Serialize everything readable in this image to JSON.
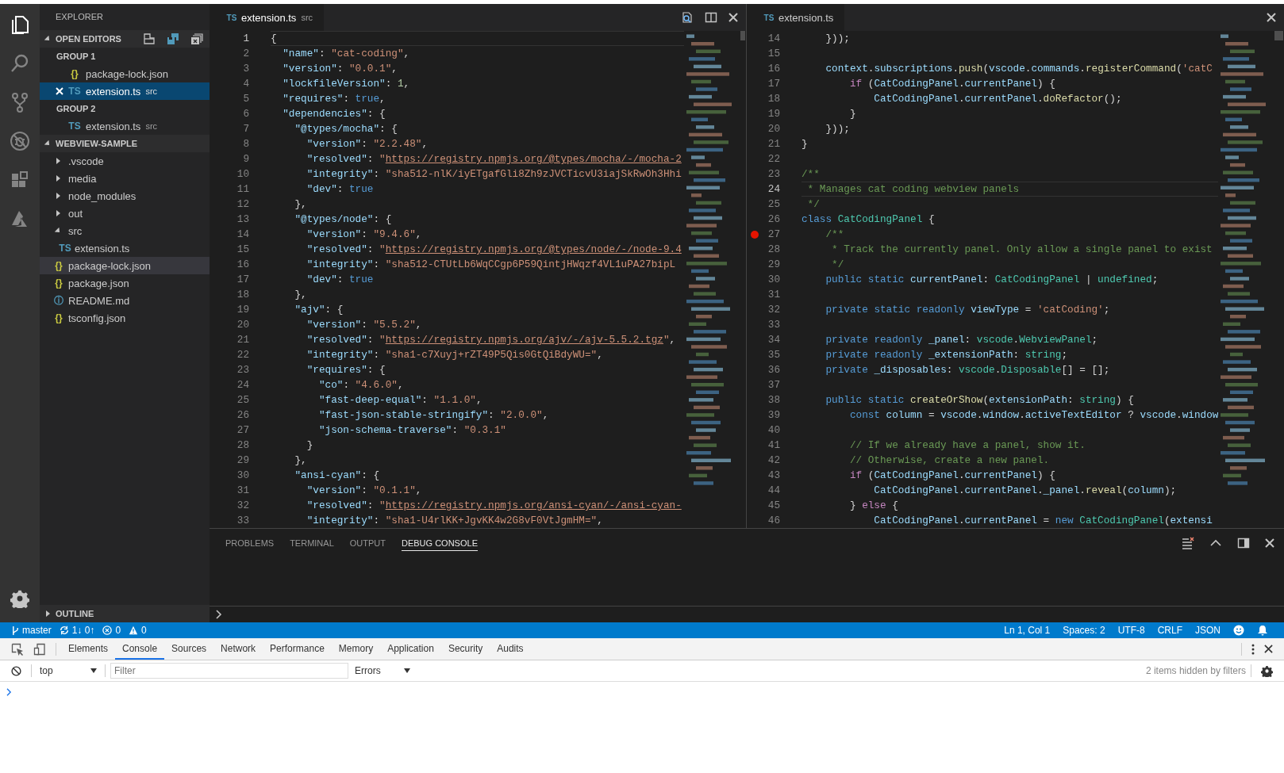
{
  "activity": [
    {
      "kind": "explorer",
      "selected": true
    },
    {
      "kind": "search",
      "selected": false
    },
    {
      "kind": "scm",
      "selected": false
    },
    {
      "kind": "debug",
      "selected": false
    },
    {
      "kind": "extensions",
      "selected": false
    },
    {
      "kind": "azure",
      "selected": false
    }
  ],
  "sidebar": {
    "title": "EXPLORER",
    "open_editors": {
      "title": "OPEN EDITORS",
      "expanded": true,
      "groups": [
        {
          "title": "GROUP 1",
          "files": [
            {
              "icon": "{}",
              "color": "#cbcb41",
              "name": "package-lock.json",
              "selected": false
            },
            {
              "icon": "TS",
              "color": "#519aba",
              "name": "extension.ts",
              "folder": "src",
              "selected": true
            }
          ]
        },
        {
          "title": "GROUP 2",
          "files": [
            {
              "icon": "TS",
              "color": "#519aba",
              "name": "extension.ts",
              "folder": "src",
              "selected": false
            }
          ]
        }
      ]
    },
    "workspace": {
      "title": "WEBVIEW-SAMPLE",
      "expanded": true,
      "items": [
        {
          "name": ".vscode",
          "kind": "folder",
          "expanded": false,
          "selected": false
        },
        {
          "name": "media",
          "kind": "folder",
          "expanded": false,
          "selected": false
        },
        {
          "name": "node_modules",
          "kind": "folder",
          "expanded": false,
          "selected": false
        },
        {
          "name": "out",
          "kind": "folder",
          "expanded": false,
          "selected": false
        },
        {
          "name": "src",
          "kind": "folder",
          "expanded": true,
          "selected": false,
          "children": [
            {
              "name": "extension.ts",
              "icon": "TS",
              "color": "#519aba",
              "selected": false
            }
          ]
        },
        {
          "name": "package-lock.json",
          "kind": "file",
          "icon": "{}",
          "color": "#cbcb41",
          "selected": true
        },
        {
          "name": "package.json",
          "kind": "file",
          "icon": "{}",
          "color": "#cbcb41",
          "selected": false
        },
        {
          "name": "README.md",
          "kind": "file",
          "icon": "ⓘ",
          "color": "#519aba",
          "selected": false
        },
        {
          "name": "tsconfig.json",
          "kind": "file",
          "icon": "{}",
          "color": "#cbcb41",
          "selected": false
        }
      ]
    },
    "outline": {
      "title": "OUTLINE",
      "expanded": false
    }
  },
  "editor_groups": [
    {
      "tab": {
        "icon": "TS",
        "name": "extension.ts",
        "folder": "src"
      },
      "actions": [
        {
          "kind": "open-changes"
        },
        {
          "kind": "split"
        },
        {
          "kind": "close"
        }
      ],
      "lines": [
        {
          "number": "1",
          "current": true,
          "tokens": [
            {
              "kind": "punct",
              "text": "{"
            }
          ]
        },
        {
          "number": "2",
          "current": false,
          "tokens": [
            {
              "kind": "key",
              "text": "  \"name\""
            },
            {
              "kind": "punct",
              "text": ": "
            },
            {
              "kind": "str",
              "text": "\"cat-coding\""
            },
            {
              "kind": "punct",
              "text": ","
            }
          ]
        },
        {
          "number": "3",
          "current": false,
          "tokens": [
            {
              "kind": "key",
              "text": "  \"version\""
            },
            {
              "kind": "punct",
              "text": ": "
            },
            {
              "kind": "str",
              "text": "\"0.0.1\""
            },
            {
              "kind": "punct",
              "text": ","
            }
          ]
        },
        {
          "number": "4",
          "current": false,
          "tokens": [
            {
              "kind": "key",
              "text": "  \"lockfileVersion\""
            },
            {
              "kind": "punct",
              "text": ": "
            },
            {
              "kind": "num",
              "text": "1"
            },
            {
              "kind": "punct",
              "text": ","
            }
          ]
        },
        {
          "number": "5",
          "current": false,
          "tokens": [
            {
              "kind": "key",
              "text": "  \"requires\""
            },
            {
              "kind": "punct",
              "text": ": "
            },
            {
              "kind": "bool",
              "text": "true"
            },
            {
              "kind": "punct",
              "text": ","
            }
          ]
        },
        {
          "number": "6",
          "current": false,
          "tokens": [
            {
              "kind": "key",
              "text": "  \"dependencies\""
            },
            {
              "kind": "punct",
              "text": ": {"
            }
          ]
        },
        {
          "number": "7",
          "current": false,
          "tokens": [
            {
              "kind": "key",
              "text": "    \"@types/mocha\""
            },
            {
              "kind": "punct",
              "text": ": {"
            }
          ]
        },
        {
          "number": "8",
          "current": false,
          "tokens": [
            {
              "kind": "key",
              "text": "      \"version\""
            },
            {
              "kind": "punct",
              "text": ": "
            },
            {
              "kind": "str",
              "text": "\"2.2.48\""
            },
            {
              "kind": "punct",
              "text": ","
            }
          ]
        },
        {
          "number": "9",
          "current": false,
          "tokens": [
            {
              "kind": "key",
              "text": "      \"resolved\""
            },
            {
              "kind": "punct",
              "text": ": "
            },
            {
              "kind": "str",
              "text": "\""
            },
            {
              "kind": "link",
              "text": "https://registry.npmjs.org/@types/mocha/-/mocha-2"
            }
          ]
        },
        {
          "number": "10",
          "current": false,
          "tokens": [
            {
              "kind": "key",
              "text": "      \"integrity\""
            },
            {
              "kind": "punct",
              "text": ": "
            },
            {
              "kind": "str",
              "text": "\"sha512-nlK/iyETgafGli8Zh9zJVCTicvU3iajSkRwOh3Hhi"
            }
          ]
        },
        {
          "number": "11",
          "current": false,
          "tokens": [
            {
              "kind": "key",
              "text": "      \"dev\""
            },
            {
              "kind": "punct",
              "text": ": "
            },
            {
              "kind": "bool",
              "text": "true"
            }
          ]
        },
        {
          "number": "12",
          "current": false,
          "tokens": [
            {
              "kind": "punct",
              "text": "    },"
            }
          ]
        },
        {
          "number": "13",
          "current": false,
          "tokens": [
            {
              "kind": "key",
              "text": "    \"@types/node\""
            },
            {
              "kind": "punct",
              "text": ": {"
            }
          ]
        },
        {
          "number": "14",
          "current": false,
          "tokens": [
            {
              "kind": "key",
              "text": "      \"version\""
            },
            {
              "kind": "punct",
              "text": ": "
            },
            {
              "kind": "str",
              "text": "\"9.4.6\""
            },
            {
              "kind": "punct",
              "text": ","
            }
          ]
        },
        {
          "number": "15",
          "current": false,
          "tokens": [
            {
              "kind": "key",
              "text": "      \"resolved\""
            },
            {
              "kind": "punct",
              "text": ": "
            },
            {
              "kind": "str",
              "text": "\""
            },
            {
              "kind": "link",
              "text": "https://registry.npmjs.org/@types/node/-/node-9.4"
            }
          ]
        },
        {
          "number": "16",
          "current": false,
          "tokens": [
            {
              "kind": "key",
              "text": "      \"integrity\""
            },
            {
              "kind": "punct",
              "text": ": "
            },
            {
              "kind": "str",
              "text": "\"sha512-CTUtLb6WqCCgp6P59QintjHWqzf4VL1uPA27bipL"
            }
          ]
        },
        {
          "number": "17",
          "current": false,
          "tokens": [
            {
              "kind": "key",
              "text": "      \"dev\""
            },
            {
              "kind": "punct",
              "text": ": "
            },
            {
              "kind": "bool",
              "text": "true"
            }
          ]
        },
        {
          "number": "18",
          "current": false,
          "tokens": [
            {
              "kind": "punct",
              "text": "    },"
            }
          ]
        },
        {
          "number": "19",
          "current": false,
          "tokens": [
            {
              "kind": "key",
              "text": "    \"ajv\""
            },
            {
              "kind": "punct",
              "text": ": {"
            }
          ]
        },
        {
          "number": "20",
          "current": false,
          "tokens": [
            {
              "kind": "key",
              "text": "      \"version\""
            },
            {
              "kind": "punct",
              "text": ": "
            },
            {
              "kind": "str",
              "text": "\"5.5.2\""
            },
            {
              "kind": "punct",
              "text": ","
            }
          ]
        },
        {
          "number": "21",
          "current": false,
          "tokens": [
            {
              "kind": "key",
              "text": "      \"resolved\""
            },
            {
              "kind": "punct",
              "text": ": "
            },
            {
              "kind": "str",
              "text": "\""
            },
            {
              "kind": "link",
              "text": "https://registry.npmjs.org/ajv/-/ajv-5.5.2.tgz"
            },
            {
              "kind": "str",
              "text": "\""
            },
            {
              "kind": "punct",
              "text": ","
            }
          ]
        },
        {
          "number": "22",
          "current": false,
          "tokens": [
            {
              "kind": "key",
              "text": "      \"integrity\""
            },
            {
              "kind": "punct",
              "text": ": "
            },
            {
              "kind": "str",
              "text": "\"sha1-c7Xuyj+rZT49P5Qis0GtQiBdyWU=\""
            },
            {
              "kind": "punct",
              "text": ","
            }
          ]
        },
        {
          "number": "23",
          "current": false,
          "tokens": [
            {
              "kind": "key",
              "text": "      \"requires\""
            },
            {
              "kind": "punct",
              "text": ": {"
            }
          ]
        },
        {
          "number": "24",
          "current": false,
          "tokens": [
            {
              "kind": "key",
              "text": "        \"co\""
            },
            {
              "kind": "punct",
              "text": ": "
            },
            {
              "kind": "str",
              "text": "\"4.6.0\""
            },
            {
              "kind": "punct",
              "text": ","
            }
          ]
        },
        {
          "number": "25",
          "current": false,
          "tokens": [
            {
              "kind": "key",
              "text": "        \"fast-deep-equal\""
            },
            {
              "kind": "punct",
              "text": ": "
            },
            {
              "kind": "str",
              "text": "\"1.1.0\""
            },
            {
              "kind": "punct",
              "text": ","
            }
          ]
        },
        {
          "number": "26",
          "current": false,
          "tokens": [
            {
              "kind": "key",
              "text": "        \"fast-json-stable-stringify\""
            },
            {
              "kind": "punct",
              "text": ": "
            },
            {
              "kind": "str",
              "text": "\"2.0.0\""
            },
            {
              "kind": "punct",
              "text": ","
            }
          ]
        },
        {
          "number": "27",
          "current": false,
          "tokens": [
            {
              "kind": "key",
              "text": "        \"json-schema-traverse\""
            },
            {
              "kind": "punct",
              "text": ": "
            },
            {
              "kind": "str",
              "text": "\"0.3.1\""
            }
          ]
        },
        {
          "number": "28",
          "current": false,
          "tokens": [
            {
              "kind": "punct",
              "text": "      }"
            }
          ]
        },
        {
          "number": "29",
          "current": false,
          "tokens": [
            {
              "kind": "punct",
              "text": "    },"
            }
          ]
        },
        {
          "number": "30",
          "current": false,
          "tokens": [
            {
              "kind": "key",
              "text": "    \"ansi-cyan\""
            },
            {
              "kind": "punct",
              "text": ": {"
            }
          ]
        },
        {
          "number": "31",
          "current": false,
          "tokens": [
            {
              "kind": "key",
              "text": "      \"version\""
            },
            {
              "kind": "punct",
              "text": ": "
            },
            {
              "kind": "str",
              "text": "\"0.1.1\""
            },
            {
              "kind": "punct",
              "text": ","
            }
          ]
        },
        {
          "number": "32",
          "current": false,
          "tokens": [
            {
              "kind": "key",
              "text": "      \"resolved\""
            },
            {
              "kind": "punct",
              "text": ": "
            },
            {
              "kind": "str",
              "text": "\""
            },
            {
              "kind": "link",
              "text": "https://registry.npmjs.org/ansi-cyan/-/ansi-cyan-"
            }
          ]
        },
        {
          "number": "33",
          "current": false,
          "tokens": [
            {
              "kind": "key",
              "text": "      \"integrity\""
            },
            {
              "kind": "punct",
              "text": ": "
            },
            {
              "kind": "str",
              "text": "\"sha1-U4rlKK+JgvKK4w2G8vF0VtJgmHM=\""
            },
            {
              "kind": "punct",
              "text": ","
            }
          ]
        }
      ]
    },
    {
      "tab": {
        "icon": "TS",
        "name": "extension.ts"
      },
      "actions": [
        {
          "kind": "close"
        }
      ],
      "lines": [
        {
          "number": "14",
          "current": false,
          "breakpoint": false,
          "tokens": [
            {
              "kind": "punct",
              "text": "    }));"
            }
          ]
        },
        {
          "number": "15",
          "current": false,
          "breakpoint": false
        },
        {
          "number": "16",
          "current": false,
          "breakpoint": false,
          "tokens": [
            {
              "kind": "var",
              "text": "    context"
            },
            {
              "kind": "punct",
              "text": "."
            },
            {
              "kind": "var",
              "text": "subscriptions"
            },
            {
              "kind": "punct",
              "text": "."
            },
            {
              "kind": "func",
              "text": "push"
            },
            {
              "kind": "punct",
              "text": "("
            },
            {
              "kind": "var",
              "text": "vscode"
            },
            {
              "kind": "punct",
              "text": "."
            },
            {
              "kind": "var",
              "text": "commands"
            },
            {
              "kind": "punct",
              "text": "."
            },
            {
              "kind": "func",
              "text": "registerCommand"
            },
            {
              "kind": "punct",
              "text": "("
            },
            {
              "kind": "str",
              "text": "'catC"
            }
          ]
        },
        {
          "number": "17",
          "current": false,
          "breakpoint": false,
          "tokens": [
            {
              "kind": "ctrl",
              "text": "        if"
            },
            {
              "kind": "punct",
              "text": " ("
            },
            {
              "kind": "var",
              "text": "CatCodingPanel"
            },
            {
              "kind": "punct",
              "text": "."
            },
            {
              "kind": "var",
              "text": "currentPanel"
            },
            {
              "kind": "punct",
              "text": ") {"
            }
          ]
        },
        {
          "number": "18",
          "current": false,
          "breakpoint": false,
          "tokens": [
            {
              "kind": "var",
              "text": "            CatCodingPanel"
            },
            {
              "kind": "punct",
              "text": "."
            },
            {
              "kind": "var",
              "text": "currentPanel"
            },
            {
              "kind": "punct",
              "text": "."
            },
            {
              "kind": "func",
              "text": "doRefactor"
            },
            {
              "kind": "punct",
              "text": "();"
            }
          ]
        },
        {
          "number": "19",
          "current": false,
          "breakpoint": false,
          "tokens": [
            {
              "kind": "punct",
              "text": "        }"
            }
          ]
        },
        {
          "number": "20",
          "current": false,
          "breakpoint": false,
          "tokens": [
            {
              "kind": "punct",
              "text": "    }));"
            }
          ]
        },
        {
          "number": "21",
          "current": false,
          "breakpoint": false,
          "tokens": [
            {
              "kind": "punct",
              "text": "}"
            }
          ]
        },
        {
          "number": "22",
          "current": false,
          "breakpoint": false
        },
        {
          "number": "23",
          "current": false,
          "breakpoint": false,
          "tokens": [
            {
              "kind": "comment",
              "text": "/**"
            }
          ]
        },
        {
          "number": "24",
          "current": true,
          "breakpoint": false,
          "tokens": [
            {
              "kind": "comment",
              "text": " * Manages cat coding webview panels"
            }
          ]
        },
        {
          "number": "25",
          "current": false,
          "breakpoint": false,
          "tokens": [
            {
              "kind": "comment",
              "text": " */"
            }
          ]
        },
        {
          "number": "26",
          "current": false,
          "breakpoint": false,
          "tokens": [
            {
              "kind": "kw",
              "text": "class "
            },
            {
              "kind": "type",
              "text": "CatCodingPanel"
            },
            {
              "kind": "punct",
              "text": " {"
            }
          ]
        },
        {
          "number": "27",
          "current": false,
          "breakpoint": true,
          "tokens": [
            {
              "kind": "comment",
              "text": "    /**"
            }
          ]
        },
        {
          "number": "28",
          "current": false,
          "breakpoint": false,
          "tokens": [
            {
              "kind": "comment",
              "text": "     * Track the currently panel. Only allow a single panel to exist"
            }
          ]
        },
        {
          "number": "29",
          "current": false,
          "breakpoint": false,
          "tokens": [
            {
              "kind": "comment",
              "text": "     */"
            }
          ]
        },
        {
          "number": "30",
          "current": false,
          "breakpoint": false,
          "tokens": [
            {
              "kind": "kw",
              "text": "    public "
            },
            {
              "kind": "kw",
              "text": "static "
            },
            {
              "kind": "var",
              "text": "currentPanel"
            },
            {
              "kind": "punct",
              "text": ": "
            },
            {
              "kind": "type",
              "text": "CatCodingPanel"
            },
            {
              "kind": "punct",
              "text": " | "
            },
            {
              "kind": "type",
              "text": "undefined"
            },
            {
              "kind": "punct",
              "text": ";"
            }
          ]
        },
        {
          "number": "31",
          "current": false,
          "breakpoint": false
        },
        {
          "number": "32",
          "current": false,
          "breakpoint": false,
          "tokens": [
            {
              "kind": "kw",
              "text": "    private "
            },
            {
              "kind": "kw",
              "text": "static "
            },
            {
              "kind": "kw",
              "text": "readonly "
            },
            {
              "kind": "var",
              "text": "viewType"
            },
            {
              "kind": "punct",
              "text": " = "
            },
            {
              "kind": "str",
              "text": "'catCoding'"
            },
            {
              "kind": "punct",
              "text": ";"
            }
          ]
        },
        {
          "number": "33",
          "current": false,
          "breakpoint": false
        },
        {
          "number": "34",
          "current": false,
          "breakpoint": false,
          "tokens": [
            {
              "kind": "kw",
              "text": "    private "
            },
            {
              "kind": "kw",
              "text": "readonly "
            },
            {
              "kind": "var",
              "text": "_panel"
            },
            {
              "kind": "punct",
              "text": ": "
            },
            {
              "kind": "type",
              "text": "vscode"
            },
            {
              "kind": "punct",
              "text": "."
            },
            {
              "kind": "type",
              "text": "WebviewPanel"
            },
            {
              "kind": "punct",
              "text": ";"
            }
          ]
        },
        {
          "number": "35",
          "current": false,
          "breakpoint": false,
          "tokens": [
            {
              "kind": "kw",
              "text": "    private "
            },
            {
              "kind": "kw",
              "text": "readonly "
            },
            {
              "kind": "var",
              "text": "_extensionPath"
            },
            {
              "kind": "punct",
              "text": ": "
            },
            {
              "kind": "type",
              "text": "string"
            },
            {
              "kind": "punct",
              "text": ";"
            }
          ]
        },
        {
          "number": "36",
          "current": false,
          "breakpoint": false,
          "tokens": [
            {
              "kind": "kw",
              "text": "    private "
            },
            {
              "kind": "var",
              "text": "_disposables"
            },
            {
              "kind": "punct",
              "text": ": "
            },
            {
              "kind": "type",
              "text": "vscode"
            },
            {
              "kind": "punct",
              "text": "."
            },
            {
              "kind": "type",
              "text": "Disposable"
            },
            {
              "kind": "punct",
              "text": "[] = [];"
            }
          ]
        },
        {
          "number": "37",
          "current": false,
          "breakpoint": false
        },
        {
          "number": "38",
          "current": false,
          "breakpoint": false,
          "tokens": [
            {
              "kind": "kw",
              "text": "    public "
            },
            {
              "kind": "kw",
              "text": "static "
            },
            {
              "kind": "func",
              "text": "createOrShow"
            },
            {
              "kind": "punct",
              "text": "("
            },
            {
              "kind": "var",
              "text": "extensionPath"
            },
            {
              "kind": "punct",
              "text": ": "
            },
            {
              "kind": "type",
              "text": "string"
            },
            {
              "kind": "punct",
              "text": ") {"
            }
          ]
        },
        {
          "number": "39",
          "current": false,
          "breakpoint": false,
          "tokens": [
            {
              "kind": "kw",
              "text": "        const "
            },
            {
              "kind": "var",
              "text": "column"
            },
            {
              "kind": "punct",
              "text": " = "
            },
            {
              "kind": "var",
              "text": "vscode"
            },
            {
              "kind": "punct",
              "text": "."
            },
            {
              "kind": "var",
              "text": "window"
            },
            {
              "kind": "punct",
              "text": "."
            },
            {
              "kind": "var",
              "text": "activeTextEditor"
            },
            {
              "kind": "punct",
              "text": " ? "
            },
            {
              "kind": "var",
              "text": "vscode"
            },
            {
              "kind": "punct",
              "text": "."
            },
            {
              "kind": "var",
              "text": "window"
            }
          ]
        },
        {
          "number": "40",
          "current": false,
          "breakpoint": false
        },
        {
          "number": "41",
          "current": false,
          "breakpoint": false,
          "tokens": [
            {
              "kind": "comment",
              "text": "        // If we already have a panel, show it."
            }
          ]
        },
        {
          "number": "42",
          "current": false,
          "breakpoint": false,
          "tokens": [
            {
              "kind": "comment",
              "text": "        // Otherwise, create a new panel."
            }
          ]
        },
        {
          "number": "43",
          "current": false,
          "breakpoint": false,
          "tokens": [
            {
              "kind": "ctrl",
              "text": "        if"
            },
            {
              "kind": "punct",
              "text": " ("
            },
            {
              "kind": "var",
              "text": "CatCodingPanel"
            },
            {
              "kind": "punct",
              "text": "."
            },
            {
              "kind": "var",
              "text": "currentPanel"
            },
            {
              "kind": "punct",
              "text": ") {"
            }
          ]
        },
        {
          "number": "44",
          "current": false,
          "breakpoint": false,
          "tokens": [
            {
              "kind": "var",
              "text": "            CatCodingPanel"
            },
            {
              "kind": "punct",
              "text": "."
            },
            {
              "kind": "var",
              "text": "currentPanel"
            },
            {
              "kind": "punct",
              "text": "."
            },
            {
              "kind": "var",
              "text": "_panel"
            },
            {
              "kind": "punct",
              "text": "."
            },
            {
              "kind": "func",
              "text": "reveal"
            },
            {
              "kind": "punct",
              "text": "("
            },
            {
              "kind": "var",
              "text": "column"
            },
            {
              "kind": "punct",
              "text": ");"
            }
          ]
        },
        {
          "number": "45",
          "current": false,
          "breakpoint": false,
          "tokens": [
            {
              "kind": "punct",
              "text": "        } "
            },
            {
              "kind": "ctrl",
              "text": "else"
            },
            {
              "kind": "punct",
              "text": " {"
            }
          ]
        },
        {
          "number": "46",
          "current": false,
          "breakpoint": false,
          "tokens": [
            {
              "kind": "var",
              "text": "            CatCodingPanel"
            },
            {
              "kind": "punct",
              "text": "."
            },
            {
              "kind": "var",
              "text": "currentPanel"
            },
            {
              "kind": "punct",
              "text": " = "
            },
            {
              "kind": "kw",
              "text": "new "
            },
            {
              "kind": "type",
              "text": "CatCodingPanel"
            },
            {
              "kind": "punct",
              "text": "("
            },
            {
              "kind": "var",
              "text": "extensi"
            }
          ]
        }
      ]
    }
  ],
  "panel": {
    "tabs": [
      {
        "label": "PROBLEMS",
        "selected": false
      },
      {
        "label": "TERMINAL",
        "selected": false
      },
      {
        "label": "OUTPUT",
        "selected": false
      },
      {
        "label": "DEBUG CONSOLE",
        "selected": true
      }
    ]
  },
  "status_bar": {
    "left": [
      {
        "kind": "branch",
        "text": "master"
      },
      {
        "kind": "sync",
        "text": "1↓ 0↑"
      },
      {
        "kind": "errors",
        "text": "0"
      },
      {
        "kind": "warnings",
        "text": "0"
      }
    ],
    "right": [
      {
        "kind": "text",
        "text": "Ln 1, Col 1"
      },
      {
        "kind": "text",
        "text": "Spaces: 2"
      },
      {
        "kind": "text",
        "text": "UTF-8"
      },
      {
        "kind": "text",
        "text": "CRLF"
      },
      {
        "kind": "text",
        "text": "JSON"
      },
      {
        "kind": "feedback"
      },
      {
        "kind": "bell"
      }
    ]
  },
  "devtools": {
    "tabs": [
      {
        "label": "Elements",
        "selected": false
      },
      {
        "label": "Console",
        "selected": true
      },
      {
        "label": "Sources",
        "selected": false
      },
      {
        "label": "Network",
        "selected": false
      },
      {
        "label": "Performance",
        "selected": false
      },
      {
        "label": "Memory",
        "selected": false
      },
      {
        "label": "Application",
        "selected": false
      },
      {
        "label": "Security",
        "selected": false
      },
      {
        "label": "Audits",
        "selected": false
      }
    ],
    "context": "top",
    "filter": {
      "placeholder": "Filter"
    },
    "level": "Errors",
    "hidden_note": "2 items hidden by filters"
  }
}
